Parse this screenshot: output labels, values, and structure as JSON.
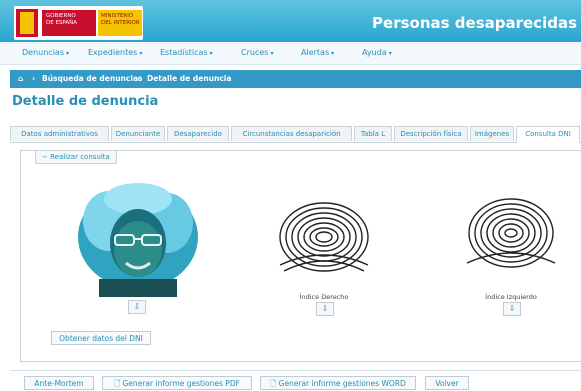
{
  "header": {
    "logo_gov_line1": "GOBIERNO",
    "logo_gov_line2": "DE ESPAÑA",
    "logo_min_line1": "MINISTERIO",
    "logo_min_line2": "DEL INTERIOR",
    "app_title": "Personas desaparecidas",
    "brand_color": "#2aa6cf"
  },
  "menu": [
    "Denuncias",
    "Expedientes",
    "Estadísticas",
    "Cruces",
    "Alertas",
    "Ayuda"
  ],
  "breadcrumb": {
    "home_icon": "home-icon",
    "items": [
      "Búsqueda de denuncias",
      "Detalle de denuncia"
    ]
  },
  "page_title": "Detalle de denuncia",
  "tabs": [
    "Datos administrativos",
    "Denunciante",
    "Desaparecido",
    "Circunstancias desaparición",
    "Tabla L",
    "Descripción física",
    "Imágenes",
    "Consulta DNI"
  ],
  "active_tab": "Consulta DNI",
  "panel": {
    "legend": "− Realizar consulta",
    "right_index_label": "Índice Derecho",
    "left_index_label": "Índice Izquierdo",
    "obtain_button": "Obtener datos del DNI"
  },
  "footer_buttons": {
    "ante_mortem": "Ante-Mortem",
    "pdf": "Generar informe gestiones PDF",
    "word": "Generar informe gestiones WORD",
    "back": "Volver"
  }
}
